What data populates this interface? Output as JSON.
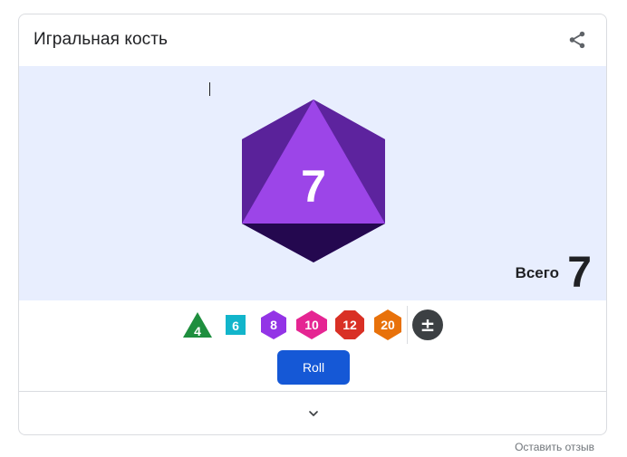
{
  "card": {
    "title": "Игральная кость",
    "share_icon": "share-icon"
  },
  "result": {
    "die_type": "d8",
    "die_value": "7",
    "total_label": "Всего",
    "total_value": "7"
  },
  "dice": [
    {
      "label": "4",
      "shape": "triangle",
      "color": "#1e8e3e"
    },
    {
      "label": "6",
      "shape": "square",
      "color": "#12b5cb"
    },
    {
      "label": "8",
      "shape": "hexagon",
      "color": "#9334e6"
    },
    {
      "label": "10",
      "shape": "diamond-hexagon",
      "color": "#e52592"
    },
    {
      "label": "12",
      "shape": "octagon",
      "color": "#d93025"
    },
    {
      "label": "20",
      "shape": "hexagon",
      "color": "#e8710a"
    },
    {
      "label": "±",
      "shape": "circle",
      "color": "#3c4043"
    }
  ],
  "actions": {
    "roll_label": "Roll",
    "expand_icon": "chevron-down-icon"
  },
  "footer": {
    "feedback_link": "Оставить отзыв"
  }
}
